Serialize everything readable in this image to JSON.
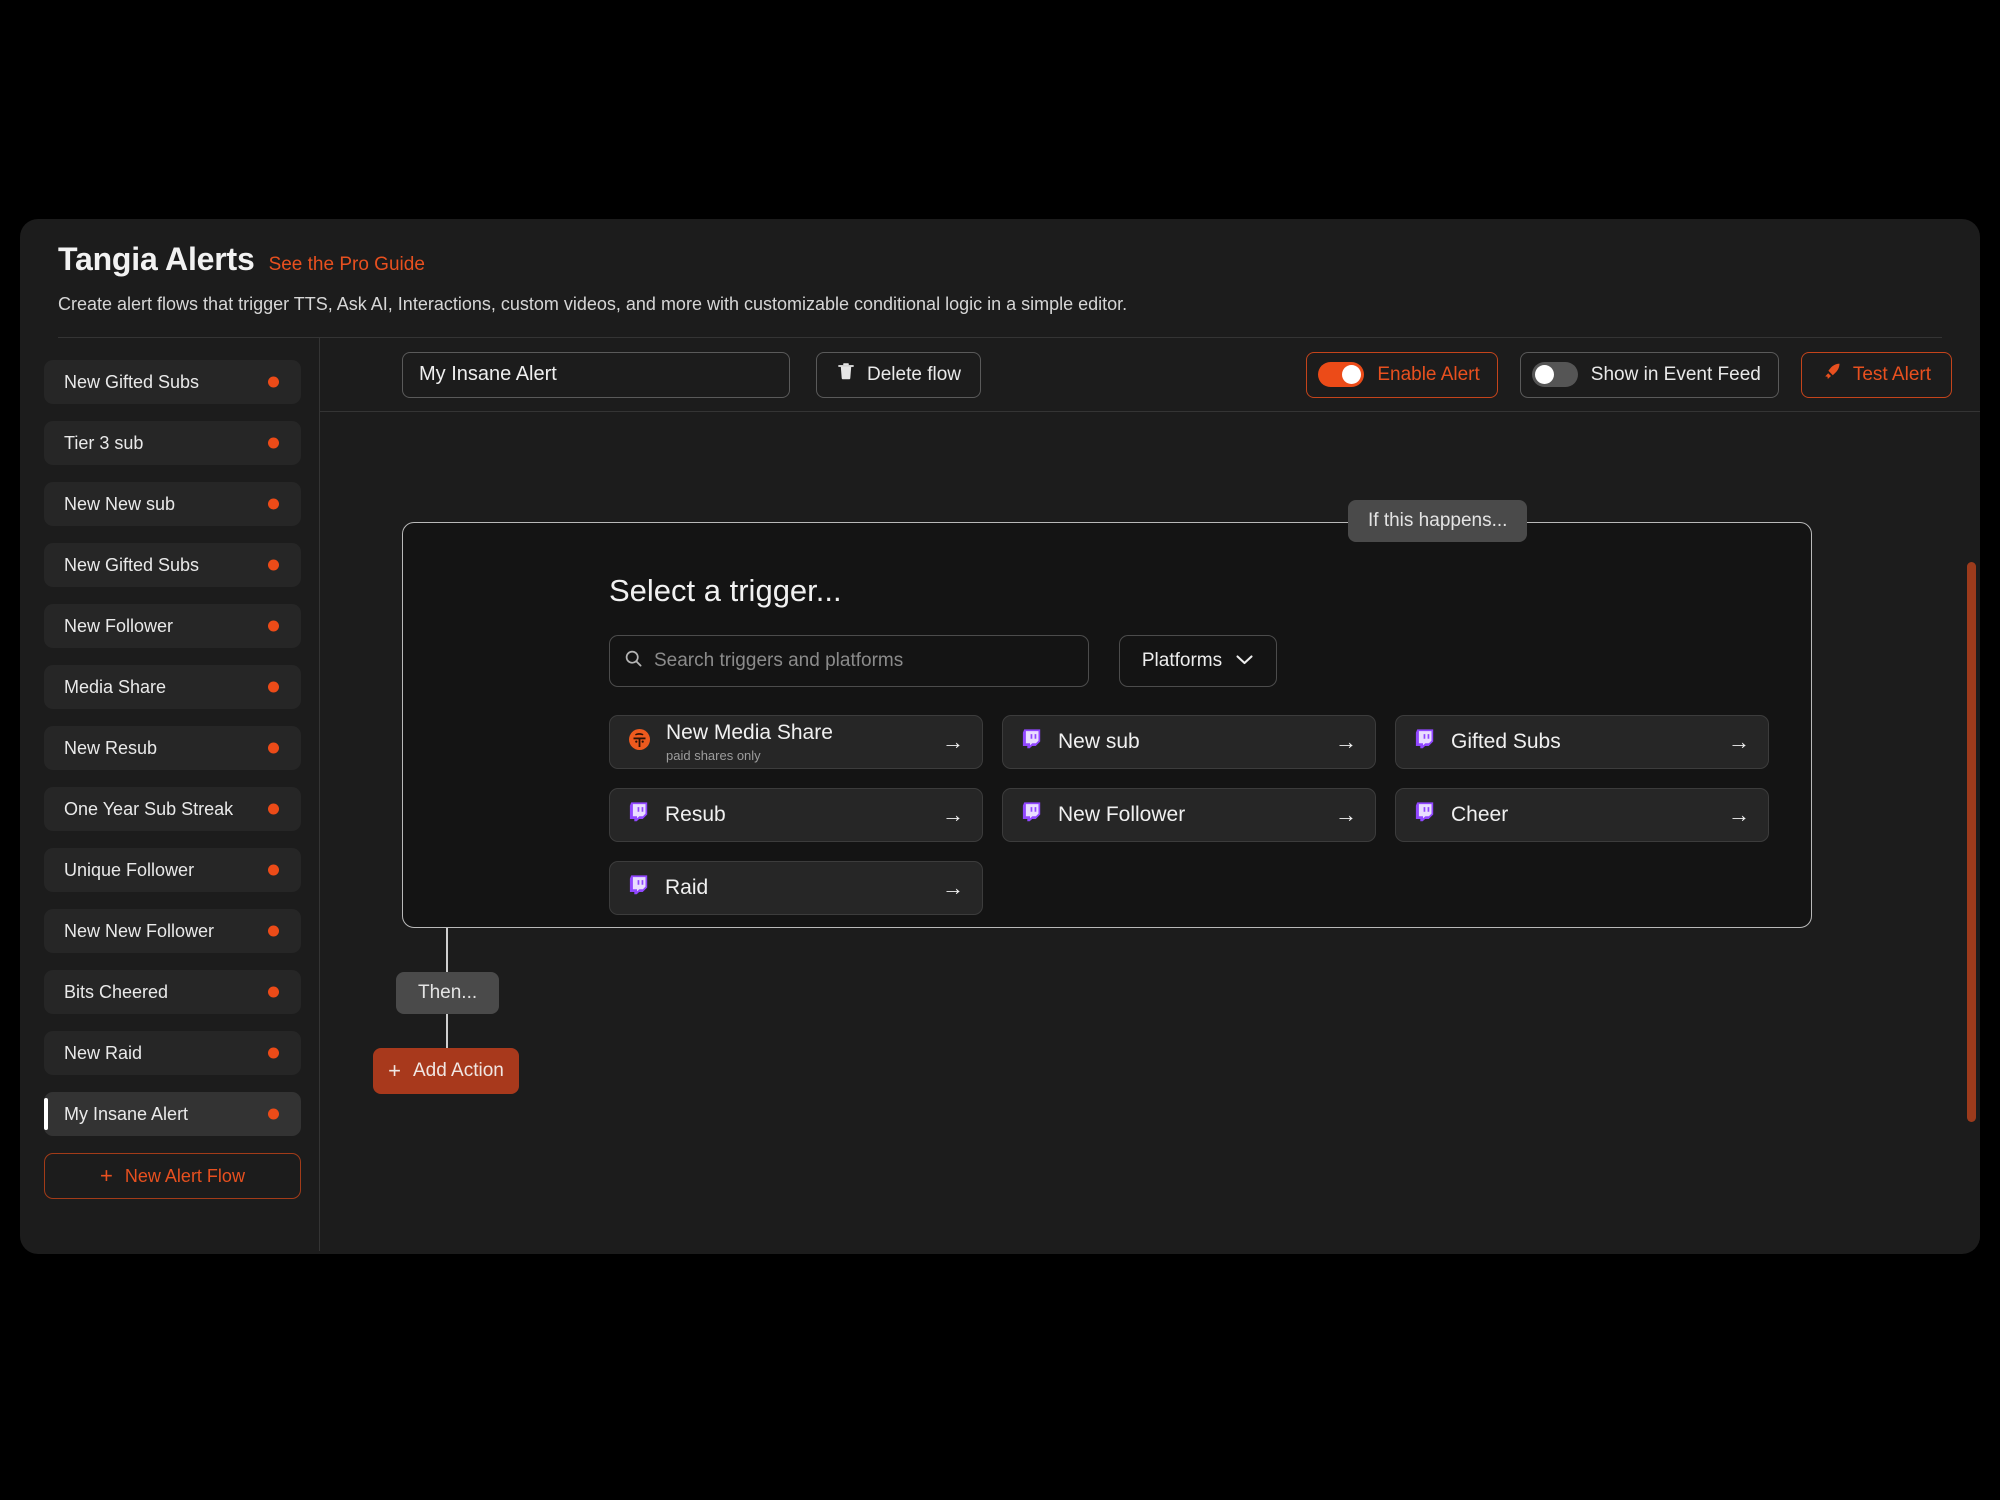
{
  "header": {
    "title": "Tangia Alerts",
    "pro_guide_link": "See the Pro Guide",
    "subtitle": "Create alert flows that trigger TTS, Ask AI, Interactions, custom videos, and more with customizable conditional logic in a simple editor."
  },
  "sidebar": {
    "items": [
      {
        "label": "New Gifted Subs",
        "selected": false
      },
      {
        "label": "Tier 3 sub",
        "selected": false
      },
      {
        "label": "New New sub",
        "selected": false
      },
      {
        "label": "New Gifted Subs",
        "selected": false
      },
      {
        "label": "New Follower",
        "selected": false
      },
      {
        "label": "Media Share",
        "selected": false
      },
      {
        "label": "New Resub",
        "selected": false
      },
      {
        "label": "One Year Sub Streak",
        "selected": false
      },
      {
        "label": "Unique Follower",
        "selected": false
      },
      {
        "label": "New New Follower",
        "selected": false
      },
      {
        "label": "Bits Cheered",
        "selected": false
      },
      {
        "label": "New Raid",
        "selected": false
      },
      {
        "label": "My Insane Alert",
        "selected": true
      }
    ],
    "new_flow_label": "New Alert Flow",
    "new_flow_plus": "+",
    "dot_color": "#ec4b18"
  },
  "toolbar": {
    "flow_name_value": "My Insane Alert",
    "flow_name_placeholder": "Flow name",
    "delete_flow_label": "Delete flow",
    "enable_alert_label": "Enable Alert",
    "enable_alert_on": true,
    "show_event_feed_label": "Show in Event Feed",
    "show_event_feed_on": false,
    "test_alert_label": "Test Alert",
    "accent_color": "#e8501f"
  },
  "canvas": {
    "if_this_happens_label": "If this happens...",
    "then_label": "Then...",
    "add_action_label": "Add Action",
    "add_action_plus": "+",
    "select_trigger_heading": "Select a trigger...",
    "search_placeholder": "Search triggers and platforms",
    "search_value": "",
    "platforms_label": "Platforms",
    "triggers": [
      {
        "label": "New Media Share",
        "sublabel": "paid shares only",
        "platform": "tangia",
        "arrow": "→"
      },
      {
        "label": "New sub",
        "sublabel": "",
        "platform": "twitch",
        "arrow": "→"
      },
      {
        "label": "Gifted Subs",
        "sublabel": "",
        "platform": "twitch",
        "arrow": "→"
      },
      {
        "label": "Resub",
        "sublabel": "",
        "platform": "twitch",
        "arrow": "→"
      },
      {
        "label": "New Follower",
        "sublabel": "",
        "platform": "twitch",
        "arrow": "→"
      },
      {
        "label": "Cheer",
        "sublabel": "",
        "platform": "twitch",
        "arrow": "→"
      },
      {
        "label": "Raid",
        "sublabel": "",
        "platform": "twitch",
        "arrow": "→"
      }
    ]
  }
}
